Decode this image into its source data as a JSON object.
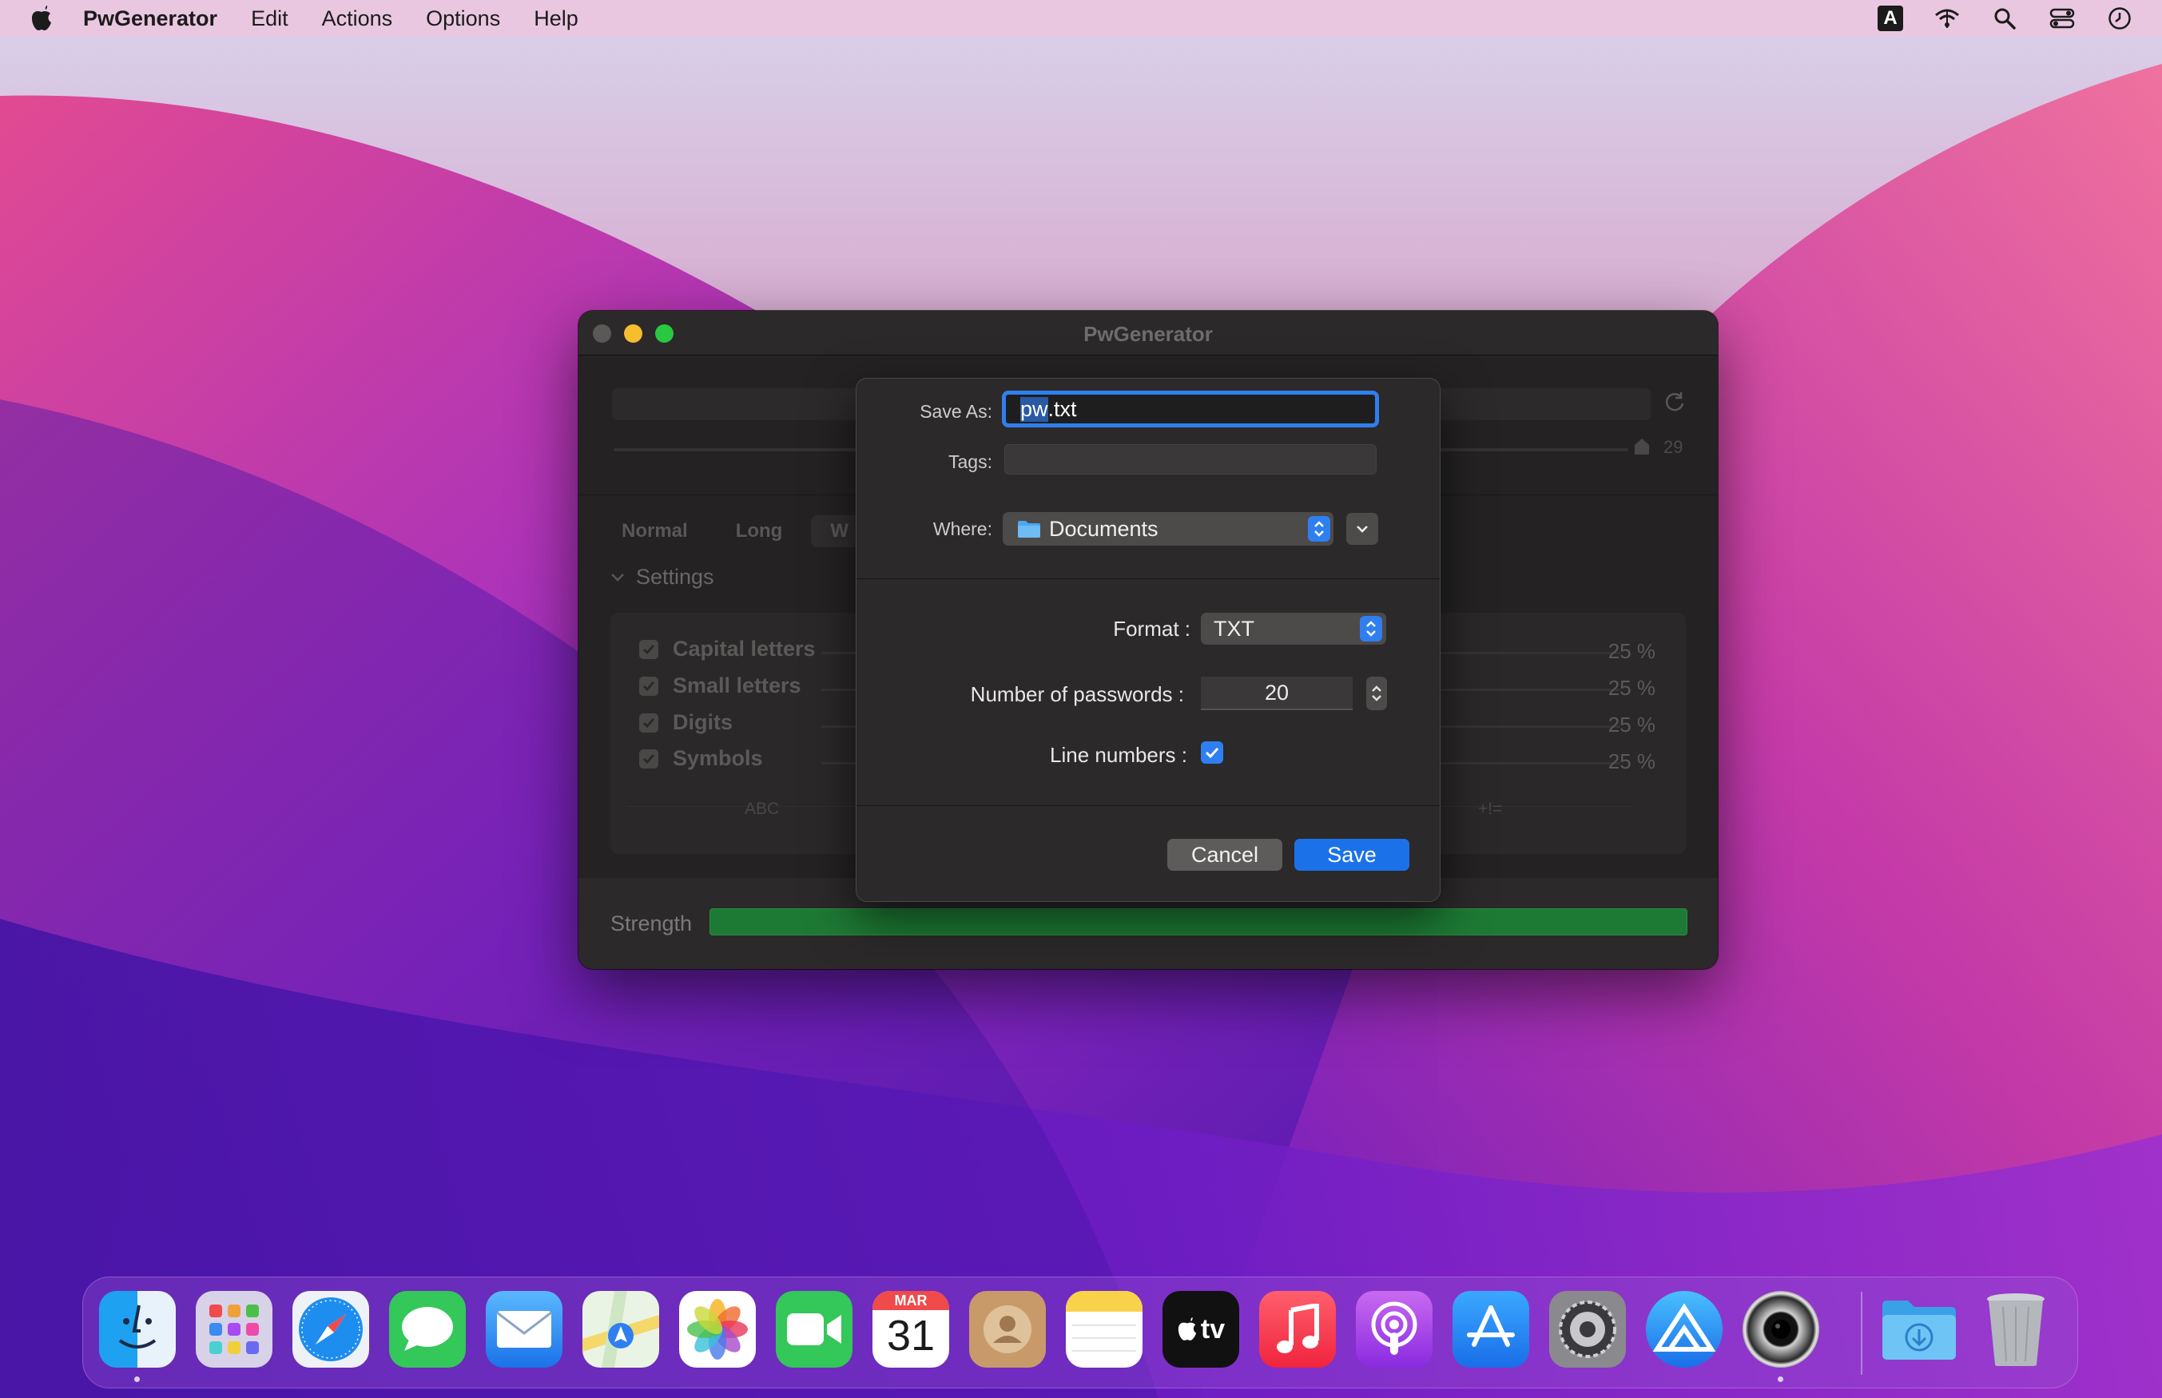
{
  "menubar": {
    "app_name": "PwGenerator",
    "menus": [
      "Edit",
      "Actions",
      "Options",
      "Help"
    ],
    "input_source_badge": "A",
    "icons": [
      "apple-icon",
      "keyboard-input-icon",
      "wifi-icon",
      "spotlight-search-icon",
      "control-center-icon",
      "clock-icon"
    ]
  },
  "window": {
    "title": "PwGenerator",
    "length_value": "29",
    "mode_tabs": [
      "Normal",
      "Long",
      "W"
    ],
    "settings_header": "Settings",
    "options": [
      {
        "label": "Capital letters",
        "percent": "25 %",
        "checked": true
      },
      {
        "label": "Small letters",
        "percent": "25 %",
        "checked": true
      },
      {
        "label": "Digits",
        "percent": "25 %",
        "checked": true
      },
      {
        "label": "Symbols",
        "percent": "25 %",
        "checked": true
      }
    ],
    "charset_left": "ABC",
    "charset_right": "+!=",
    "strength_label": "Strength",
    "strength_level": 1.0
  },
  "sheet": {
    "save_as_label": "Save As:",
    "save_as_value_selected": "pw",
    "save_as_value_rest": ".txt",
    "tags_label": "Tags:",
    "where_label": "Where:",
    "where_value": "Documents",
    "format_label": "Format :",
    "format_value": "TXT",
    "count_label": "Number of passwords :",
    "count_value": "20",
    "line_numbers_label": "Line numbers :",
    "line_numbers_checked": true,
    "cancel_label": "Cancel",
    "save_label": "Save"
  },
  "dock": {
    "apps": [
      "finder",
      "launchpad",
      "safari",
      "messages",
      "mail",
      "maps",
      "photos",
      "facetime",
      "calendar",
      "contacts",
      "notes",
      "apple-tv",
      "music",
      "podcasts",
      "app-store",
      "system-preferences",
      "affinity",
      "camera-utility",
      "downloads",
      "trash"
    ],
    "calendar_month": "MAR",
    "calendar_day": "31",
    "tv_label": "tv"
  },
  "colors": {
    "accent": "#2f7ff0",
    "strength": "#1d7a34"
  }
}
